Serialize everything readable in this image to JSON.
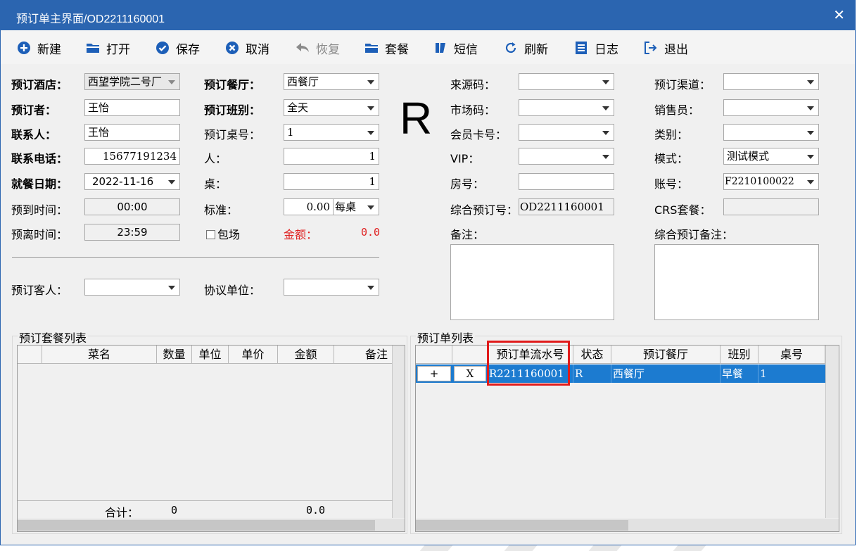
{
  "window": {
    "title": "预订单主界面/OD2211160001",
    "close": "✕"
  },
  "toolbar": {
    "new": "新建",
    "open": "打开",
    "save": "保存",
    "cancel": "取消",
    "restore": "恢复",
    "package": "套餐",
    "sms": "短信",
    "refresh": "刷新",
    "log": "日志",
    "exit": "退出"
  },
  "form": {
    "hotel_label": "预订酒店：",
    "hotel_value": "西望学院二号厂",
    "booker_label": "预订者：",
    "booker_value": "王怡",
    "contact_label": "联系人：",
    "contact_value": "王怡",
    "phone_label": "联系电话：",
    "phone_value": "15677191234",
    "date_label": "就餐日期：",
    "date_value": "2022-11-16",
    "arrive_label": "预到时间：",
    "arrive_value": "00:00",
    "leave_label": "预离时间：",
    "leave_value": "23:59",
    "restaurant_label": "预订餐厅：",
    "restaurant_value": "西餐厅",
    "shift_label": "预订班别：",
    "shift_value": "全天",
    "table_no_label": "预订桌号：",
    "table_no_value": "1",
    "people_label": "人：",
    "people_value": "1",
    "tables_label": "桌：",
    "tables_value": "1",
    "standard_label": "标准：",
    "standard_value": "0.00",
    "standard_unit": "每桌",
    "exclusive_label": "包场",
    "amount_label": "金额：",
    "amount_value": "0.0",
    "status_big": "R",
    "guest_label": "预订客人：",
    "guest_value": "",
    "agreement_label": "协议单位：",
    "agreement_value": "",
    "source_label": "来源码：",
    "source_value": "",
    "market_label": "市场码：",
    "market_value": "",
    "member_label": "会员卡号：",
    "member_value": "",
    "vip_label": "VIP：",
    "vip_value": "",
    "room_label": "房号：",
    "room_value": "",
    "combined_label": "综合预订号：",
    "combined_value": "OD2211160001",
    "remark_label": "备注：",
    "channel_label": "预订渠道：",
    "channel_value": "",
    "sales_label": "销售员：",
    "sales_value": "",
    "category_label": "类别：",
    "category_value": "",
    "mode_label": "模式：",
    "mode_value": "测试模式",
    "account_label": "账号：",
    "account_value": "F2210100022",
    "crs_label": "CRS套餐：",
    "crs_value": "",
    "combined_remark_label": "综合预订备注："
  },
  "package_list": {
    "title": "预订套餐列表",
    "columns": [
      "菜名",
      "数量",
      "单位",
      "单价",
      "金额",
      "备注"
    ],
    "total_label": "合计：",
    "total_qty": "0",
    "total_amount": "0.0"
  },
  "order_list": {
    "title": "预订单列表",
    "columns": [
      "预订单流水号",
      "状态",
      "预订餐厅",
      "班别",
      "桌号"
    ],
    "rows": [
      {
        "add": "+",
        "del": "X",
        "serial": "R2211160001",
        "status": "R",
        "restaurant": "西餐厅",
        "shift": "早餐",
        "table": "1"
      }
    ]
  }
}
